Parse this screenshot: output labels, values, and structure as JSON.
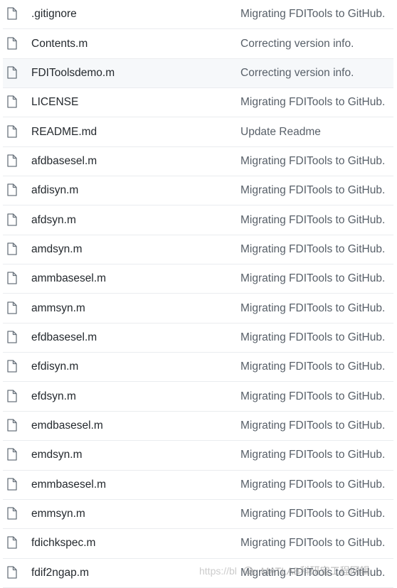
{
  "files": [
    {
      "name": ".gitignore",
      "message": "Migrating FDITools to GitHub."
    },
    {
      "name": "Contents.m",
      "message": "Correcting version info."
    },
    {
      "name": "FDIToolsdemo.m",
      "message": "Correcting version info.",
      "highlighted": true
    },
    {
      "name": "LICENSE",
      "message": "Migrating FDITools to GitHub."
    },
    {
      "name": "README.md",
      "message": "Update Readme"
    },
    {
      "name": "afdbasesel.m",
      "message": "Migrating FDITools to GitHub."
    },
    {
      "name": "afdisyn.m",
      "message": "Migrating FDITools to GitHub."
    },
    {
      "name": "afdsyn.m",
      "message": "Migrating FDITools to GitHub."
    },
    {
      "name": "amdsyn.m",
      "message": "Migrating FDITools to GitHub."
    },
    {
      "name": "ammbasesel.m",
      "message": "Migrating FDITools to GitHub."
    },
    {
      "name": "ammsyn.m",
      "message": "Migrating FDITools to GitHub."
    },
    {
      "name": "efdbasesel.m",
      "message": "Migrating FDITools to GitHub."
    },
    {
      "name": "efdisyn.m",
      "message": "Migrating FDITools to GitHub."
    },
    {
      "name": "efdsyn.m",
      "message": "Migrating FDITools to GitHub."
    },
    {
      "name": "emdbasesel.m",
      "message": "Migrating FDITools to GitHub."
    },
    {
      "name": "emdsyn.m",
      "message": "Migrating FDITools to GitHub."
    },
    {
      "name": "emmbasesel.m",
      "message": "Migrating FDITools to GitHub."
    },
    {
      "name": "emmsyn.m",
      "message": "Migrating FDITools to GitHub."
    },
    {
      "name": "fdichkspec.m",
      "message": "Migrating FDITools to GitHub."
    },
    {
      "name": "fdif2ngap.m",
      "message": "Migrating FDITools to GitHub."
    }
  ],
  "icons": {
    "file": "file-icon"
  },
  "colors": {
    "text": "#24292e",
    "message": "#586069",
    "icon": "#6a737d",
    "border": "#eaecef",
    "highlight": "#f6f8fa"
  },
  "watermark": {
    "url_text": "https://bl",
    "brand_text": "MATLAB科研宝工程网辑"
  }
}
